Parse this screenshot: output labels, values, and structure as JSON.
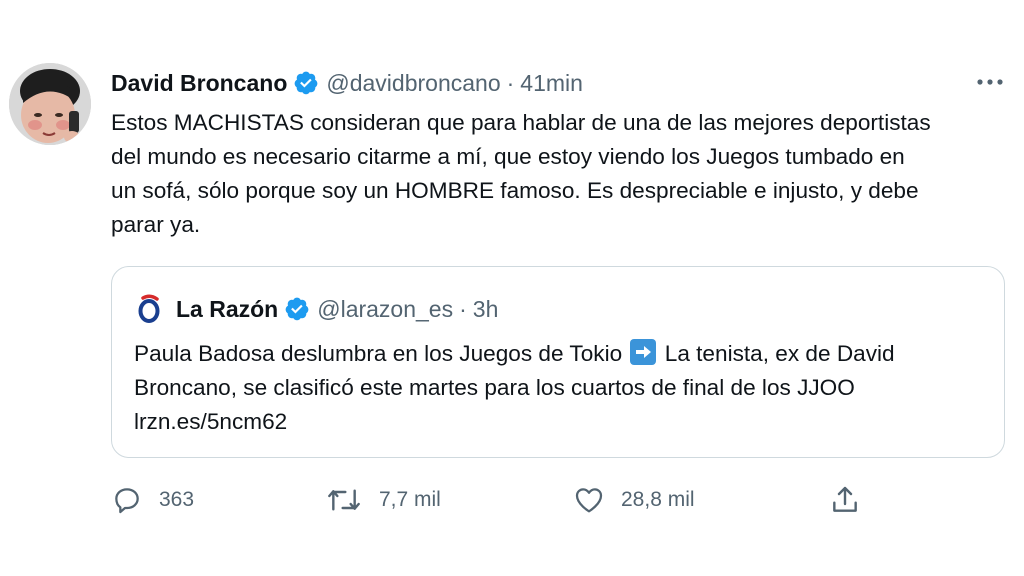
{
  "tweet": {
    "author_name": "David Broncano",
    "author_handle": "@davidbroncano",
    "separator": "·",
    "timestamp": "41min",
    "text": "Estos MACHISTAS consideran que para hablar de una de las mejores deportistas del mundo es necesario citarme a mí, que estoy viendo los Juegos tumbado en un sofá, sólo porque soy un HOMBRE famoso. Es despreciable e injusto, y debe parar ya."
  },
  "quoted": {
    "author_name": "La Razón",
    "author_handle": "@larazon_es",
    "separator": "·",
    "timestamp": "3h",
    "text_before": "Paula Badosa deslumbra en los Juegos de Tokio",
    "text_after": "La tenista, ex de David Broncano, se clasificó este martes para los cuartos de final de los JJOO lrzn.es/5ncm62"
  },
  "actions": {
    "replies": "363",
    "retweets": "7,7 mil",
    "likes": "28,8 mil"
  },
  "icons": [
    "verified-badge-icon",
    "more-icon",
    "reply-icon",
    "retweet-icon",
    "like-icon",
    "share-icon",
    "arrow-right-emoji-icon"
  ],
  "colors": {
    "verified": "#1d9bf0",
    "secondary_text": "#536471",
    "border": "#cfd9de",
    "logo_red": "#d62b2b",
    "logo_blue": "#1a3f8f"
  }
}
